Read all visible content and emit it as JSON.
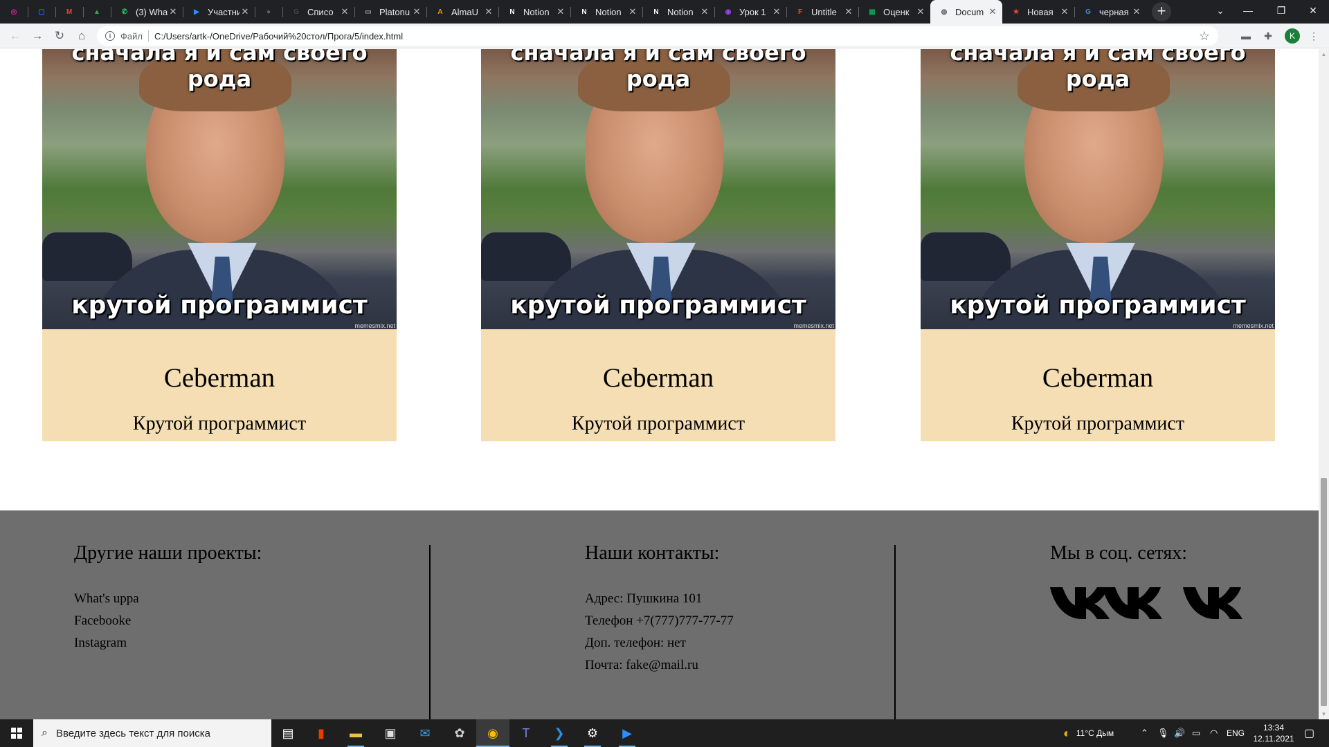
{
  "browser": {
    "tabs": [
      {
        "title": "",
        "favicon": "instagram-icon",
        "color": "#d6249f",
        "glyph": "◎"
      },
      {
        "title": "",
        "favicon": "messenger-icon",
        "color": "#1a73e8",
        "glyph": "▢"
      },
      {
        "title": "",
        "favicon": "gmail-icon",
        "color": "#ea4335",
        "glyph": "M"
      },
      {
        "title": "",
        "favicon": "google-drive-icon",
        "color": "#34a853",
        "glyph": "▲"
      },
      {
        "title": "(3) Wha",
        "favicon": "whatsapp-icon",
        "color": "#25d366",
        "glyph": "✆"
      },
      {
        "title": "Участни",
        "favicon": "zoom-icon",
        "color": "#2d8cff",
        "glyph": "▶"
      },
      {
        "title": "",
        "favicon": "circle-icon",
        "color": "#5f6368",
        "glyph": "●"
      },
      {
        "title": "Списо",
        "favicon": "google-classroom-icon",
        "color": "#444746",
        "glyph": "G"
      },
      {
        "title": "Platonu",
        "favicon": "page-icon",
        "color": "#9aa0a6",
        "glyph": "▭"
      },
      {
        "title": "AlmaU",
        "favicon": "almau-icon",
        "color": "#f29900",
        "glyph": "A"
      },
      {
        "title": "Notion",
        "favicon": "notion-icon",
        "color": "#ffffff",
        "glyph": "N"
      },
      {
        "title": "Notion",
        "favicon": "notion-icon",
        "color": "#ffffff",
        "glyph": "N"
      },
      {
        "title": "Notion",
        "favicon": "notion-icon",
        "color": "#ffffff",
        "glyph": "N"
      },
      {
        "title": "Урок 1",
        "favicon": "lesson-icon",
        "color": "#a142f4",
        "glyph": "◉"
      },
      {
        "title": "Untitle",
        "favicon": "figma-icon",
        "color": "#f24e1e",
        "glyph": "F"
      },
      {
        "title": "Оценк",
        "favicon": "google-sheets-icon",
        "color": "#0f9d58",
        "glyph": "▦"
      },
      {
        "title": "Docum",
        "favicon": "globe-icon",
        "color": "#5f6368",
        "glyph": "◍",
        "active": true
      },
      {
        "title": "Новая",
        "favicon": "new-tab-icon",
        "color": "#ea4335",
        "glyph": "★"
      },
      {
        "title": "черная",
        "favicon": "google-icon",
        "color": "#4285f4",
        "glyph": "G"
      }
    ],
    "new_tab_label": "+",
    "address": {
      "scheme_label": "Файл",
      "url": "C:/Users/artk-/OneDrive/Рабочий%20стол/Прога/5/index.html"
    },
    "avatar_letter": "K"
  },
  "cards": [
    {
      "image_top_text": "сначала я и сам своего рода",
      "image_bottom_text": "крутой программист",
      "watermark": "memesmix.net",
      "name": "Ceberman",
      "role": "Крутой программист"
    },
    {
      "image_top_text": "сначала я и сам своего рода",
      "image_bottom_text": "крутой программист",
      "watermark": "memesmix.net",
      "name": "Ceberman",
      "role": "Крутой программист"
    },
    {
      "image_top_text": "сначала я и сам своего рода",
      "image_bottom_text": "крутой программист",
      "watermark": "memesmix.net",
      "name": "Ceberman",
      "role": "Крутой программист"
    }
  ],
  "footer": {
    "projects": {
      "heading": "Другие наши проекты:",
      "links": [
        "What's uppa",
        "Facebooke",
        "Instagram"
      ]
    },
    "contacts": {
      "heading": "Наши контакты:",
      "lines": [
        "Адрес: Пушкина 101",
        "Телефон +7(777)777-77-77",
        "Доп. телефон: нет",
        "Почта: fake@mail.ru"
      ]
    },
    "social": {
      "heading": "Мы в соц. сетях:",
      "icons": [
        "vk-icon",
        "vk-icon",
        "vk-icon"
      ]
    }
  },
  "taskbar": {
    "search_placeholder": "Введите здесь текст для поиска",
    "weather": "11°C Дым",
    "language": "ENG",
    "time": "13:34",
    "date": "12.11.2021"
  }
}
